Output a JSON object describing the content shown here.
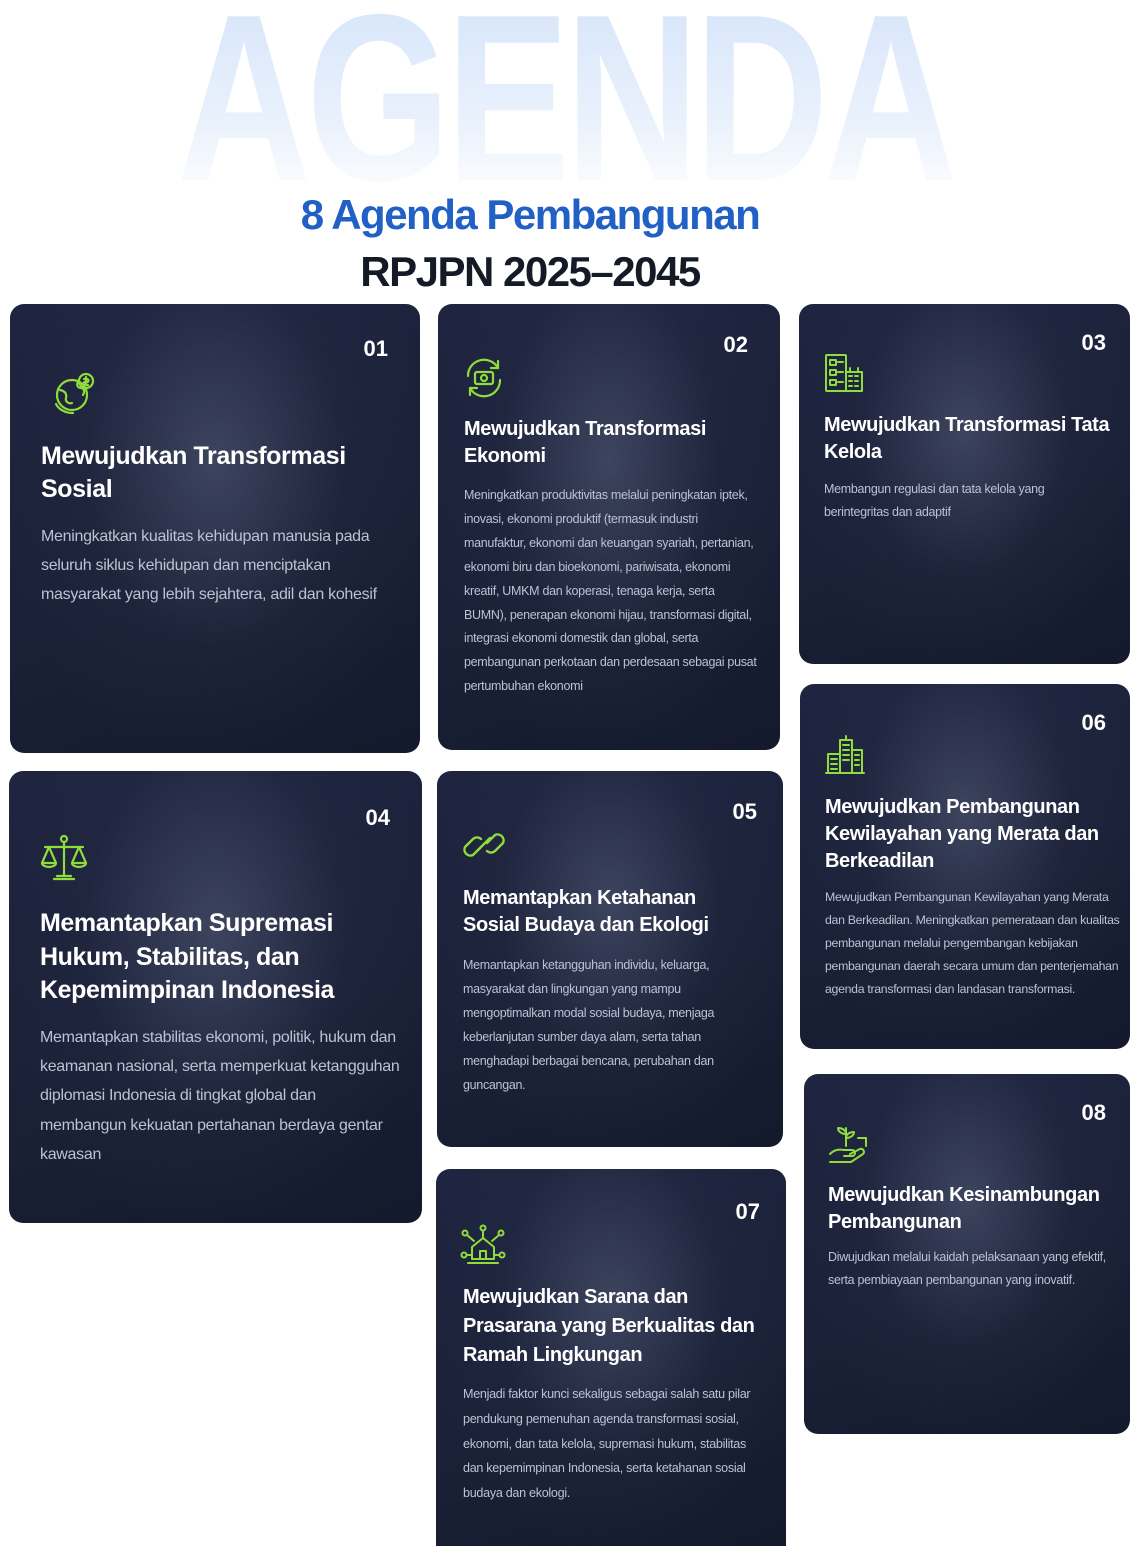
{
  "header": {
    "watermark": "AGENDA",
    "title": "8 Agenda Pembangunan",
    "subtitle": "RPJPN 2025–2045"
  },
  "colors": {
    "accent_icon": "#8fdc3c",
    "title_blue": "#2160c4",
    "card_bg": "#1b2138"
  },
  "cards": [
    {
      "number": "01",
      "icon": "globe-growth-icon",
      "title": "Mewujudkan Transformasi Sosial",
      "description": "Meningkatkan kualitas kehidupan manusia pada seluruh siklus kehidupan dan menciptakan masyarakat yang lebih sejahtera, adil dan kohesif"
    },
    {
      "number": "02",
      "icon": "money-cycle-icon",
      "title": "Mewujudkan Transformasi Ekonomi",
      "description": "Meningkatkan produktivitas melalui peningkatan iptek, inovasi, ekonomi produktif (termasuk industri manufaktur, ekonomi dan keuangan syariah, pertanian, ekonomi biru dan bioekonomi, pariwisata, ekonomi kreatif, UMKM dan koperasi, tenaga kerja, serta BUMN), penerapan ekonomi hijau, transformasi digital, integrasi ekonomi domestik dan global, serta pembangunan perkotaan dan perdesaan sebagai pusat pertumbuhan ekonomi"
    },
    {
      "number": "03",
      "icon": "governance-building-icon",
      "title": "Mewujudkan Transformasi Tata Kelola",
      "description": "Membangun regulasi dan tata kelola yang berintegritas dan adaptif"
    },
    {
      "number": "04",
      "icon": "justice-scale-icon",
      "title": "Memantapkan Supremasi Hukum, Stabilitas, dan Kepemimpinan Indonesia",
      "description": "Memantapkan stabilitas ekonomi, politik, hukum dan keamanan nasional, serta memperkuat ketangguhan diplomasi Indonesia di tingkat global dan membangun kekuatan pertahanan berdaya gentar kawasan"
    },
    {
      "number": "05",
      "icon": "chain-link-icon",
      "title": "Memantapkan Ketahanan Sosial Budaya dan Ekologi",
      "description": "Memantapkan ketangguhan individu, keluarga, masyarakat dan lingkungan yang mampu mengoptimalkan modal sosial budaya, menjaga keberlanjutan sumber daya alam, serta tahan menghadapi berbagai bencana, perubahan dan guncangan."
    },
    {
      "number": "06",
      "icon": "city-buildings-icon",
      "title": "Mewujudkan Pembangunan Kewilayahan yang Merata dan Berkeadilan",
      "description": "Mewujudkan Pembangunan Kewilayahan yang Merata dan Berkeadilan. Meningkatkan pemerataan dan kualitas pembangunan melalui pengembangan kebijakan pembangunan daerah secara umum dan penterjemahan agenda transformasi dan landasan transformasi."
    },
    {
      "number": "07",
      "icon": "smart-home-network-icon",
      "title": "Mewujudkan Sarana dan Prasarana yang Berkualitas dan Ramah Lingkungan",
      "description": "Menjadi faktor kunci sekaligus sebagai salah satu pilar pendukung pemenuhan agenda transformasi sosial, ekonomi, dan tata kelola, supremasi hukum, stabilitas dan kepemimpinan Indonesia, serta ketahanan sosial budaya dan ekologi."
    },
    {
      "number": "08",
      "icon": "sustainable-development-icon",
      "title": "Mewujudkan Kesinambungan Pembangunan",
      "description": "Diwujudkan melalui kaidah pelaksanaan yang efektif, serta pembiayaan pembangunan yang inovatif."
    }
  ]
}
